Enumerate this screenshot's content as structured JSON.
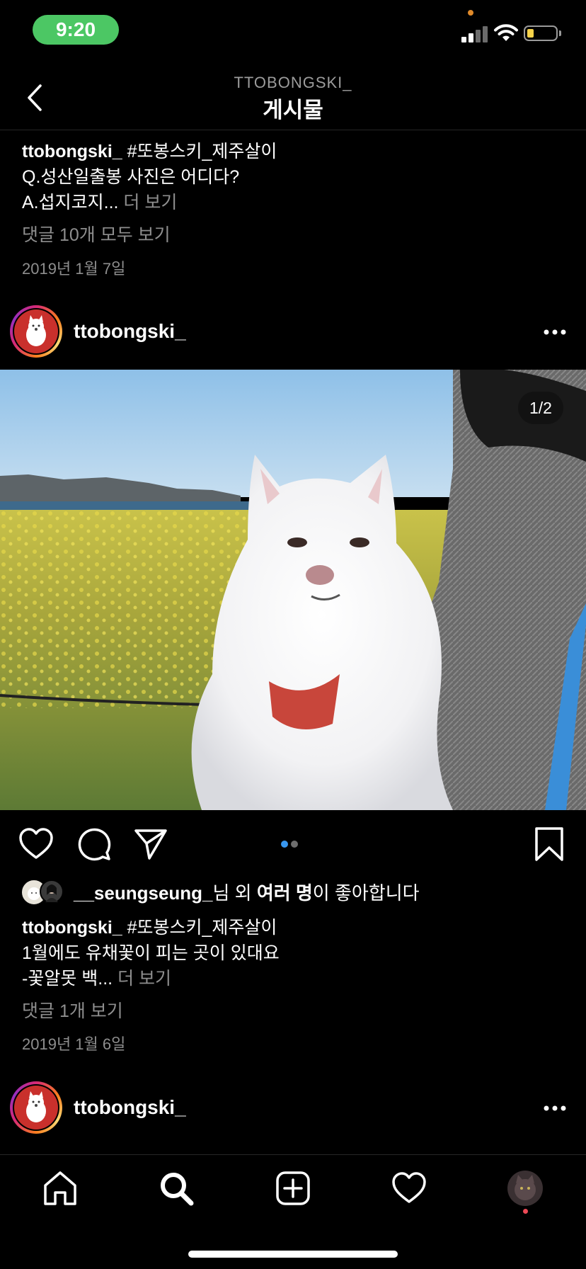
{
  "status_bar": {
    "time": "9:20",
    "accent_color": "#4cc764",
    "battery_color": "#f7d34a"
  },
  "header": {
    "subtitle": "TTOBONGSKI_",
    "title": "게시물",
    "back_icon": "chevron-left-icon"
  },
  "previous_post": {
    "caption_username": "ttobongski_",
    "caption_tag": "#또봉스키_제주살이",
    "caption_line2": "Q.성산일출봉 사진은 어디다?",
    "caption_line3": "A.섭지코지...",
    "more_label": "더 보기",
    "comments_link": "댓글 10개 모두 보기",
    "date": "2019년 1월 7일"
  },
  "post": {
    "username": "ttobongski_",
    "counter": "1/2",
    "carousel": {
      "count": 2,
      "active_index": 0,
      "active_color": "#3897f0"
    },
    "likes": {
      "liker": "__seungseung_",
      "suffix_1": "님 외 ",
      "others": "여러 명",
      "suffix_2": "이 좋아합니다"
    },
    "caption_username": "ttobongski_",
    "caption_tag": "#또봉스키_제주살이",
    "caption_line2": "1월에도 유채꽃이 피는 곳이 있대요",
    "caption_line3": "-꽃알못 백...",
    "more_label": "더 보기",
    "comments_link": "댓글 1개 보기",
    "date": "2019년 1월 6일"
  },
  "next_post": {
    "username": "ttobongski_"
  },
  "bottom_nav": {
    "items": [
      "home-icon",
      "search-icon",
      "new-post-icon",
      "activity-heart-icon",
      "profile-avatar"
    ],
    "notification_dot_color": "#ed4956"
  }
}
